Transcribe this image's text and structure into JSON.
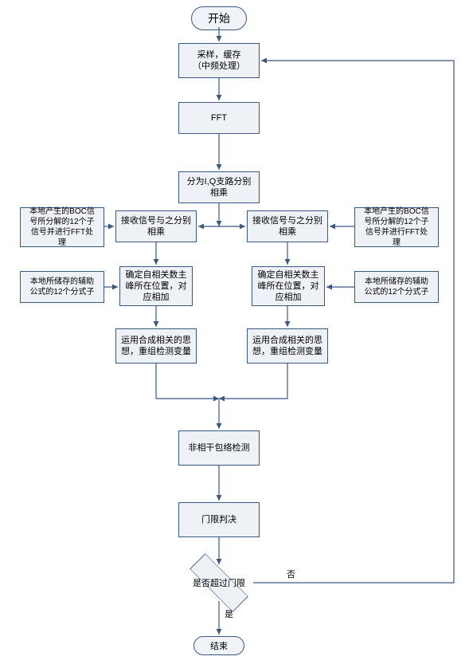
{
  "terminator": {
    "start": "开始",
    "end": "结束"
  },
  "center": {
    "sample_cache": "采样，缓存\n（中频处理）",
    "fft": "FFT",
    "split_iq": "分为I,Q支路分别\n相乘",
    "envelope": "非相干包络检测",
    "threshold": "门限判决"
  },
  "branches": {
    "left": {
      "boc_gen": "本地产生的BOC信\n号所分解的12个子\n信号并进行FFT处\n理",
      "rx_mult": "接收信号与之分别\n相乘",
      "stored_aux": "本地所储存的辅助\n公式的12个分式子",
      "locate_peak": "确定自相关数主\n峰所在位置，对\n应相加",
      "recombine": "运用合成相关的思\n想，重组检测变量"
    },
    "right": {
      "boc_gen": "本地产生的BOC信\n号所分解的12个子\n信号并进行FFT处\n理",
      "rx_mult": "接收信号与之分别\n相乘",
      "stored_aux": "本地所储存的辅助\n公式的12个分式子",
      "locate_peak": "确定自相关数主\n峰所在位置，对\n应相加",
      "recombine": "运用合成相关的思\n想，重组检测变量"
    }
  },
  "decision": {
    "label": "是否超过门限"
  },
  "edges": {
    "no": "否",
    "yes": "是"
  }
}
